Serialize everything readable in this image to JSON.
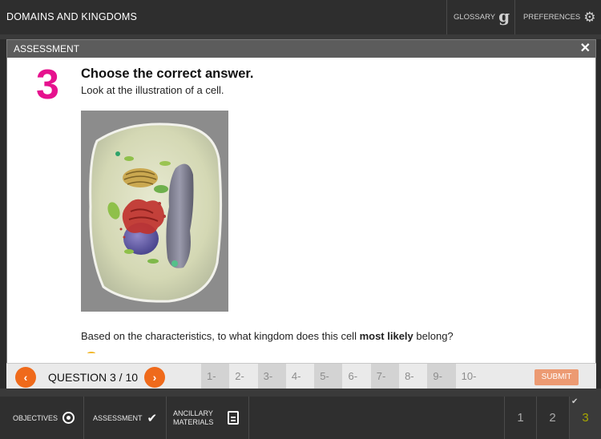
{
  "app": {
    "title": "DOMAINS AND KINGDOMS"
  },
  "topbar": {
    "glossary_label": "GLOSSARY",
    "glossary_icon": "g-icon",
    "preferences_label": "PREFERENCES",
    "preferences_icon": "gear-icon"
  },
  "modal": {
    "title": "ASSESSMENT",
    "close_glyph": "✕"
  },
  "question": {
    "number": "3",
    "heading": "Choose the correct answer.",
    "instruction": "Look at the illustration of a cell.",
    "prompt_before": "Based on the characteristics, to what kingdom does this cell ",
    "prompt_bold": "most likely",
    "prompt_after": " belong?"
  },
  "qnav": {
    "prev_glyph": "‹",
    "next_glyph": "›",
    "counter": "QUESTION 3 / 10",
    "tabs": [
      "1-",
      "2-",
      "3-",
      "4-",
      "5-",
      "6-",
      "7-",
      "8-",
      "9-",
      "10-"
    ],
    "submit_label": "SUBMIT"
  },
  "bottombar": {
    "objectives_label": "OBJECTIVES",
    "assessment_label": "ASSESSMENT",
    "assessment_glyph": "✔",
    "ancillary_label": "ANCILLARY MATERIALS",
    "pages": [
      "1",
      "2",
      "3"
    ],
    "completed_glyph": "✔"
  },
  "colors": {
    "accent_pink": "#e6128e",
    "accent_orange": "#ef6a1b",
    "submit_disabled": "#ec9a72",
    "active_page": "#a7a700"
  }
}
